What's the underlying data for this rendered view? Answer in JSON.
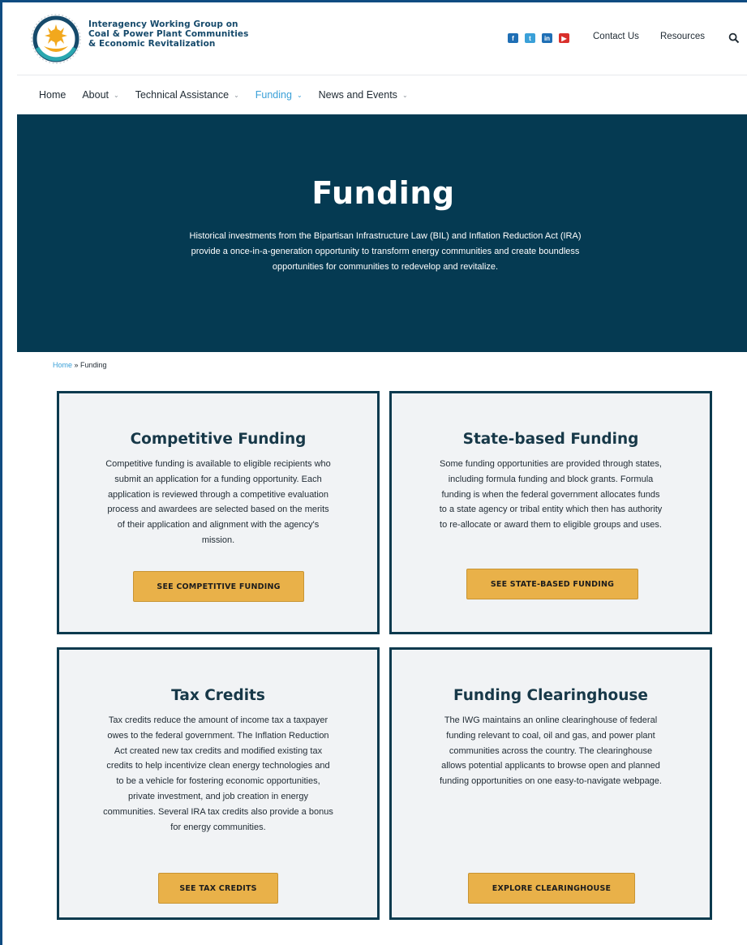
{
  "header": {
    "org_name_lines": [
      "Interagency Working Group on",
      "Coal & Power Plant Communities",
      "& Economic Revitalization"
    ],
    "social": [
      {
        "icon": "facebook-icon",
        "glyph": "f",
        "color": "#1f6fb5"
      },
      {
        "icon": "twitter-icon",
        "glyph": "t",
        "color": "#3aa0d8"
      },
      {
        "icon": "linkedin-icon",
        "glyph": "in",
        "color": "#1f6fb5"
      },
      {
        "icon": "youtube-icon",
        "glyph": "▶",
        "color": "#d9302c"
      }
    ],
    "contact_label": "Contact Us",
    "resources_label": "Resources",
    "search_icon": "search-icon"
  },
  "nav": {
    "items": [
      {
        "label": "Home",
        "dropdown": false,
        "active": false
      },
      {
        "label": "About",
        "dropdown": true,
        "active": false
      },
      {
        "label": "Technical Assistance",
        "dropdown": true,
        "active": false
      },
      {
        "label": "Funding",
        "dropdown": true,
        "active": true
      },
      {
        "label": "News and Events",
        "dropdown": true,
        "active": false
      }
    ]
  },
  "hero": {
    "title": "Funding",
    "lines": [
      "Historical investments from the Bipartisan Infrastructure Law (BIL) and Inflation Reduction Act (IRA)",
      "provide a once-in-a-generation opportunity to transform energy communities and create boundless",
      "opportunities for communities to redevelop and revitalize."
    ]
  },
  "breadcrumb": {
    "home": "Home",
    "separator": " » ",
    "current": "Funding"
  },
  "cards": [
    {
      "title": "Competitive Funding",
      "lines": [
        "Competitive funding is available to eligible recipients who",
        "submit an application for a funding opportunity. Each",
        "application is reviewed through a competitive evaluation",
        "process and awardees are selected based on the merits",
        "of their application and alignment with the agency's",
        "mission."
      ],
      "button": "SEE COMPETITIVE FUNDING"
    },
    {
      "title": "State-based Funding",
      "lines": [
        "Some funding opportunities are provided through states,",
        "including formula funding and block grants. Formula",
        "funding is when the federal government allocates funds",
        "to a state agency or tribal entity which then has authority",
        "to re-allocate or award them to eligible groups and uses."
      ],
      "button": "SEE STATE-BASED FUNDING"
    },
    {
      "title": "Tax Credits",
      "lines": [
        "Tax credits reduce the amount of income tax a taxpayer",
        "owes to the federal government. The Inflation Reduction",
        "Act created new tax credits and modified existing tax",
        "credits to help incentivize clean energy technologies and",
        "to be a vehicle for fostering economic opportunities,",
        "private investment, and job creation in energy",
        "communities. Several IRA tax credits also provide a bonus",
        "for energy communities."
      ],
      "button": "SEE TAX CREDITS"
    },
    {
      "title": "Funding Clearinghouse",
      "lines": [
        "The IWG maintains an online clearinghouse of federal",
        "funding relevant to coal, oil and gas, and power plant",
        "communities across the country. The clearinghouse",
        "allows potential applicants to browse open and planned",
        "funding opportunities on one easy-to-navigate webpage."
      ],
      "button": "EXPLORE CLEARINGHOUSE"
    }
  ],
  "colors": {
    "hero_bg": "#053a52",
    "card_border": "#0c3a4e",
    "card_bg": "#f1f3f5",
    "button_bg": "#e9b149",
    "link": "#3aa0d8",
    "frame_accent": "#0f4c81"
  }
}
